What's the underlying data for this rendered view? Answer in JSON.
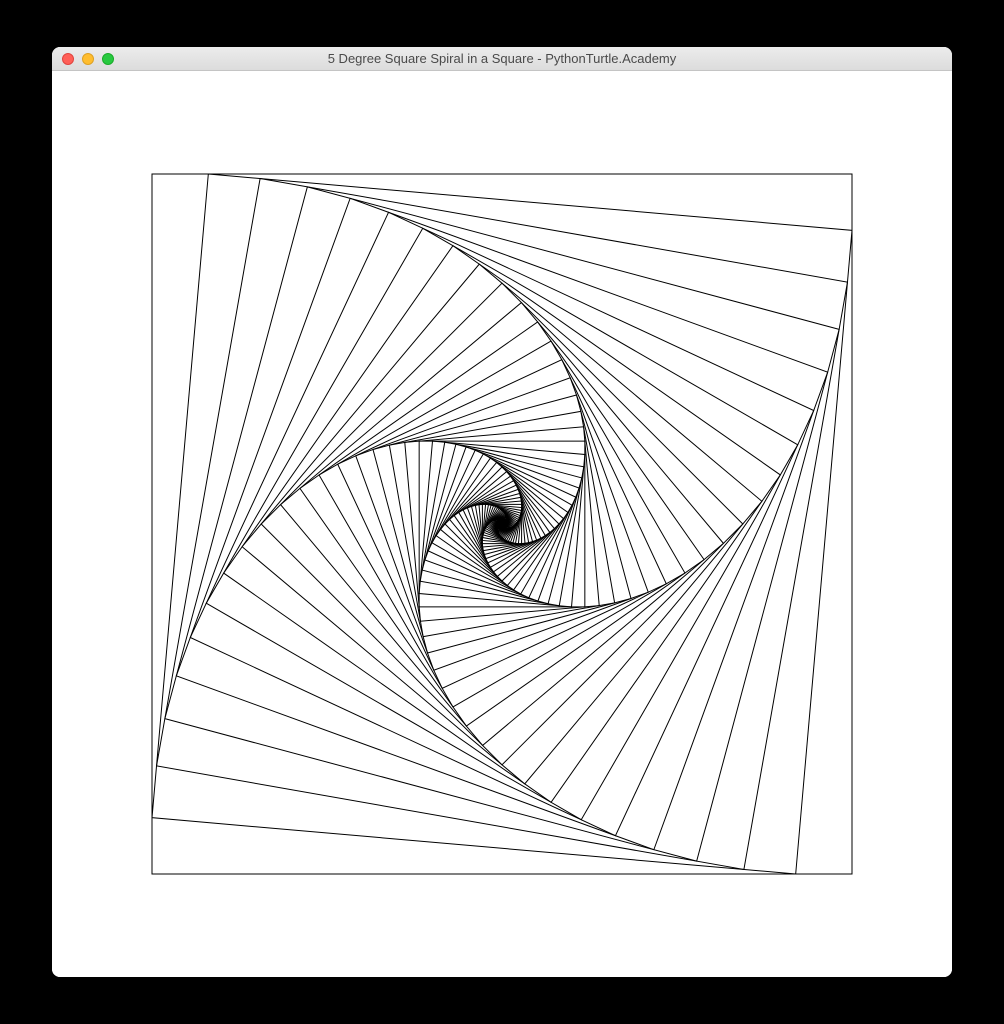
{
  "window": {
    "title": "5 Degree Square Spiral in a Square - PythonTurtle.Academy"
  },
  "traffic_lights": {
    "close_color": "#ff5f57",
    "minimize_color": "#ffbd2e",
    "maximize_color": "#28c940"
  },
  "drawing": {
    "type": "square-spiral",
    "angle_degrees": 5,
    "iterations": 100,
    "initial_side": 700,
    "stroke": "#000000",
    "stroke_width": 1,
    "background": "#ffffff",
    "canvas_margin": 100
  }
}
